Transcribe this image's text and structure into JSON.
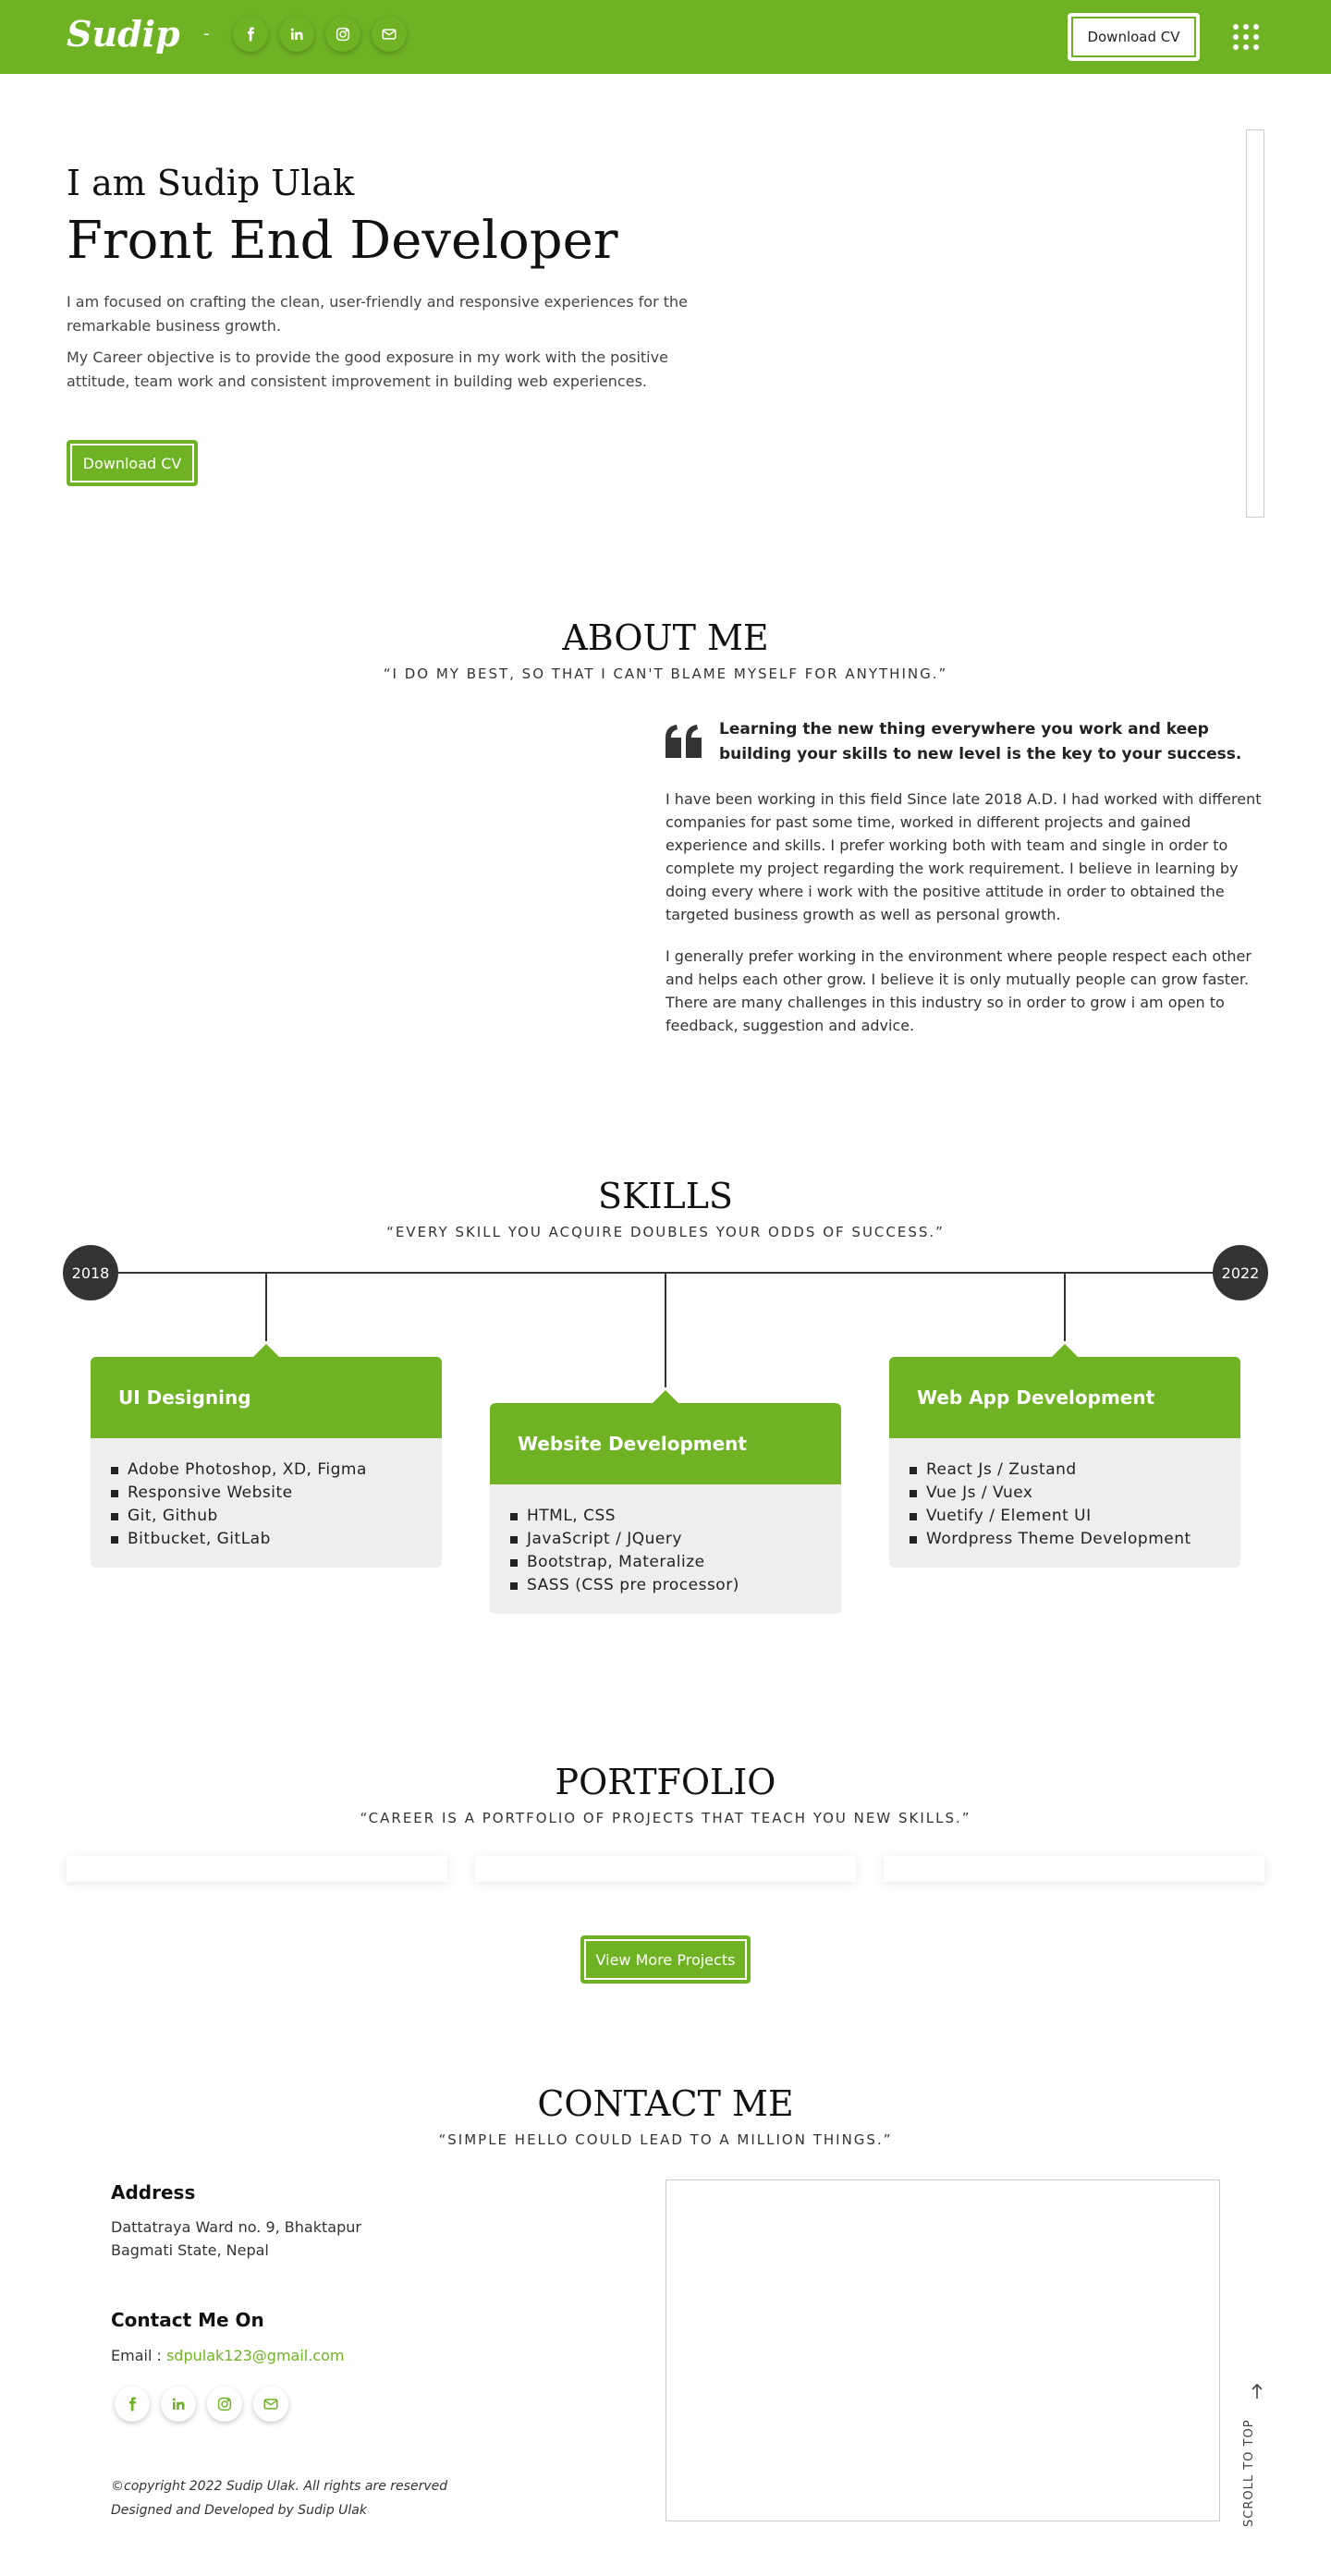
{
  "header": {
    "logo": "Sudip",
    "dash": "-",
    "social_icons": [
      "facebook-icon",
      "linkedin-icon",
      "instagram-icon",
      "envelope-icon"
    ],
    "cv_label": "Download CV",
    "menu_icon": "grid-icon"
  },
  "hero": {
    "greeting": "I am Sudip Ulak",
    "title": "Front End Developer",
    "p1": "I am focused on crafting the clean, user-friendly and responsive experiences for the remarkable business growth.",
    "p2": "My Career objective is to provide the good exposure in my work with the positive attitude, team work and consistent improvement in building web experiences.",
    "cv_label": "Download CV"
  },
  "about": {
    "title": "ABOUT ME",
    "subtitle": "“I DO MY BEST, SO THAT I CAN'T BLAME MYSELF FOR ANYTHING.”",
    "quote": "Learning the new thing everywhere you work and keep building your skills to new level is the key to your success.",
    "p1": "I have been working in this field Since late 2018 A.D. I had worked with different companies for past some time, worked in different projects and gained experience and skills. I prefer working both with team and single in order to complete my project regarding the work requirement. I believe in learning by doing every where i work with the positive attitude in order to obtained the targeted business growth as well as personal growth.",
    "p2": "I generally prefer working in the environment where people respect each other and helps each other grow. I believe it is only mutually people can grow faster. There are many challenges in this industry so in order to grow i am open to feedback, suggestion and advice."
  },
  "skills": {
    "title": "SKILLS",
    "subtitle": "“EVERY SKILL YOU ACQUIRE DOUBLES YOUR ODDS OF SUCCESS.”",
    "year_start": "2018",
    "year_end": "2022",
    "cards": [
      {
        "title": "UI Designing",
        "items": [
          "Adobe Photoshop, XD, Figma",
          "Responsive Website",
          "Git, Github",
          "Bitbucket, GitLab"
        ]
      },
      {
        "title": "Website Development",
        "items": [
          "HTML, CSS",
          "JavaScript / JQuery",
          "Bootstrap, Materalize",
          "SASS (CSS pre processor)"
        ]
      },
      {
        "title": "Web App Development",
        "items": [
          "React Js / Zustand",
          "Vue Js / Vuex",
          "Vuetify / Element UI",
          "Wordpress Theme Development"
        ]
      }
    ]
  },
  "portfolio": {
    "title": "PORTFOLIO",
    "subtitle": "“CAREER IS A PORTFOLIO OF PROJECTS THAT TEACH YOU NEW SKILLS.”",
    "button": "View More Projects"
  },
  "contact": {
    "title": "CONTACT ME",
    "subtitle": "“SIMPLE HELLO COULD LEAD TO A MILLION THINGS.”",
    "address_heading": "Address",
    "address_line1": "Dattatraya Ward no. 9, Bhaktapur",
    "address_line2": "Bagmati State, Nepal",
    "contact_heading": "Contact Me On",
    "email_label": "Email : ",
    "email": "sdpulak123@gmail.com",
    "copyright": "©copyright 2022 Sudip Ulak. All rights are reserved",
    "designed": "Designed and Developed by Sudip Ulak",
    "scroll_top": "SCROLL TO TOP"
  },
  "colors": {
    "accent": "#6fb324",
    "dark": "#333333",
    "card_bg": "#eeeeee"
  }
}
